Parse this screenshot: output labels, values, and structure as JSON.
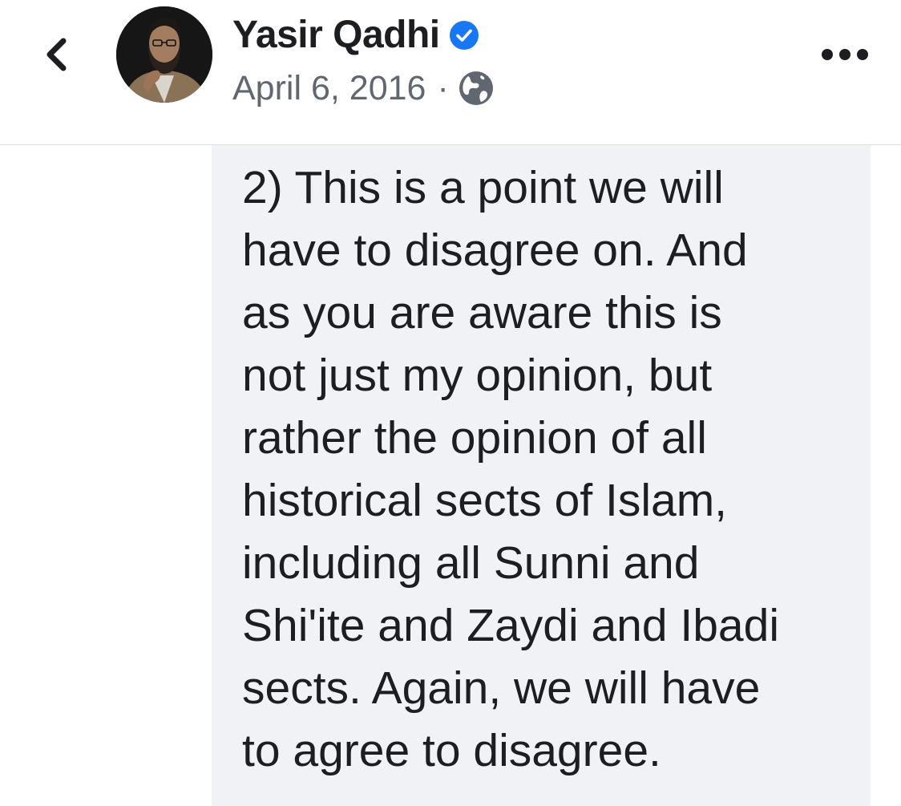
{
  "header": {
    "author_name": "Yasir Qadhi",
    "date": "April 6, 2016",
    "separator": "·",
    "icons": {
      "back": "chevron-left-icon",
      "verified": "verified-badge-icon",
      "privacy": "globe-icon",
      "more": "more-options-icon"
    }
  },
  "comment": {
    "text": "2) This is a point we will\nhave to disagree on. And\nas you are aware this is\nnot just my opinion, but\nrather the opinion of all\nhistorical sects of Islam,\nincluding all Sunni and\nShi'ite and Zaydi and Ibadi\nsects. Again, we will have\nto agree to disagree."
  },
  "colors": {
    "verified_blue": "#1877f2",
    "bubble_background": "#f0f2f5",
    "text_primary": "#1c1e21",
    "text_secondary": "#606770"
  }
}
